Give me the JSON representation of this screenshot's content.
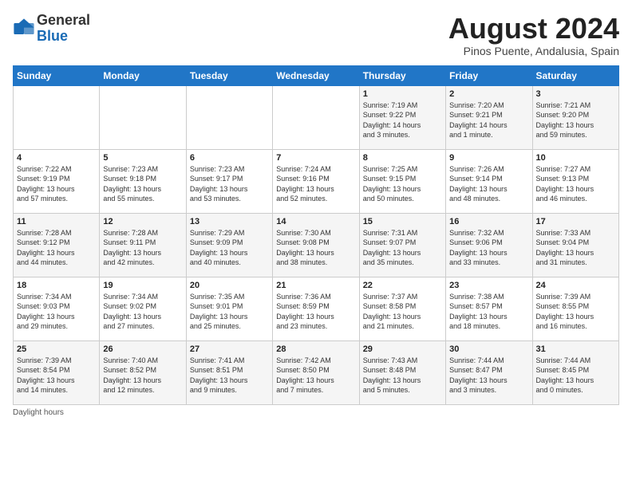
{
  "logo": {
    "general": "General",
    "blue": "Blue"
  },
  "title": "August 2024",
  "subtitle": "Pinos Puente, Andalusia, Spain",
  "days_of_week": [
    "Sunday",
    "Monday",
    "Tuesday",
    "Wednesday",
    "Thursday",
    "Friday",
    "Saturday"
  ],
  "footer": "Daylight hours",
  "weeks": [
    [
      {
        "num": "",
        "info": ""
      },
      {
        "num": "",
        "info": ""
      },
      {
        "num": "",
        "info": ""
      },
      {
        "num": "",
        "info": ""
      },
      {
        "num": "1",
        "info": "Sunrise: 7:19 AM\nSunset: 9:22 PM\nDaylight: 14 hours\nand 3 minutes."
      },
      {
        "num": "2",
        "info": "Sunrise: 7:20 AM\nSunset: 9:21 PM\nDaylight: 14 hours\nand 1 minute."
      },
      {
        "num": "3",
        "info": "Sunrise: 7:21 AM\nSunset: 9:20 PM\nDaylight: 13 hours\nand 59 minutes."
      }
    ],
    [
      {
        "num": "4",
        "info": "Sunrise: 7:22 AM\nSunset: 9:19 PM\nDaylight: 13 hours\nand 57 minutes."
      },
      {
        "num": "5",
        "info": "Sunrise: 7:23 AM\nSunset: 9:18 PM\nDaylight: 13 hours\nand 55 minutes."
      },
      {
        "num": "6",
        "info": "Sunrise: 7:23 AM\nSunset: 9:17 PM\nDaylight: 13 hours\nand 53 minutes."
      },
      {
        "num": "7",
        "info": "Sunrise: 7:24 AM\nSunset: 9:16 PM\nDaylight: 13 hours\nand 52 minutes."
      },
      {
        "num": "8",
        "info": "Sunrise: 7:25 AM\nSunset: 9:15 PM\nDaylight: 13 hours\nand 50 minutes."
      },
      {
        "num": "9",
        "info": "Sunrise: 7:26 AM\nSunset: 9:14 PM\nDaylight: 13 hours\nand 48 minutes."
      },
      {
        "num": "10",
        "info": "Sunrise: 7:27 AM\nSunset: 9:13 PM\nDaylight: 13 hours\nand 46 minutes."
      }
    ],
    [
      {
        "num": "11",
        "info": "Sunrise: 7:28 AM\nSunset: 9:12 PM\nDaylight: 13 hours\nand 44 minutes."
      },
      {
        "num": "12",
        "info": "Sunrise: 7:28 AM\nSunset: 9:11 PM\nDaylight: 13 hours\nand 42 minutes."
      },
      {
        "num": "13",
        "info": "Sunrise: 7:29 AM\nSunset: 9:09 PM\nDaylight: 13 hours\nand 40 minutes."
      },
      {
        "num": "14",
        "info": "Sunrise: 7:30 AM\nSunset: 9:08 PM\nDaylight: 13 hours\nand 38 minutes."
      },
      {
        "num": "15",
        "info": "Sunrise: 7:31 AM\nSunset: 9:07 PM\nDaylight: 13 hours\nand 35 minutes."
      },
      {
        "num": "16",
        "info": "Sunrise: 7:32 AM\nSunset: 9:06 PM\nDaylight: 13 hours\nand 33 minutes."
      },
      {
        "num": "17",
        "info": "Sunrise: 7:33 AM\nSunset: 9:04 PM\nDaylight: 13 hours\nand 31 minutes."
      }
    ],
    [
      {
        "num": "18",
        "info": "Sunrise: 7:34 AM\nSunset: 9:03 PM\nDaylight: 13 hours\nand 29 minutes."
      },
      {
        "num": "19",
        "info": "Sunrise: 7:34 AM\nSunset: 9:02 PM\nDaylight: 13 hours\nand 27 minutes."
      },
      {
        "num": "20",
        "info": "Sunrise: 7:35 AM\nSunset: 9:01 PM\nDaylight: 13 hours\nand 25 minutes."
      },
      {
        "num": "21",
        "info": "Sunrise: 7:36 AM\nSunset: 8:59 PM\nDaylight: 13 hours\nand 23 minutes."
      },
      {
        "num": "22",
        "info": "Sunrise: 7:37 AM\nSunset: 8:58 PM\nDaylight: 13 hours\nand 21 minutes."
      },
      {
        "num": "23",
        "info": "Sunrise: 7:38 AM\nSunset: 8:57 PM\nDaylight: 13 hours\nand 18 minutes."
      },
      {
        "num": "24",
        "info": "Sunrise: 7:39 AM\nSunset: 8:55 PM\nDaylight: 13 hours\nand 16 minutes."
      }
    ],
    [
      {
        "num": "25",
        "info": "Sunrise: 7:39 AM\nSunset: 8:54 PM\nDaylight: 13 hours\nand 14 minutes."
      },
      {
        "num": "26",
        "info": "Sunrise: 7:40 AM\nSunset: 8:52 PM\nDaylight: 13 hours\nand 12 minutes."
      },
      {
        "num": "27",
        "info": "Sunrise: 7:41 AM\nSunset: 8:51 PM\nDaylight: 13 hours\nand 9 minutes."
      },
      {
        "num": "28",
        "info": "Sunrise: 7:42 AM\nSunset: 8:50 PM\nDaylight: 13 hours\nand 7 minutes."
      },
      {
        "num": "29",
        "info": "Sunrise: 7:43 AM\nSunset: 8:48 PM\nDaylight: 13 hours\nand 5 minutes."
      },
      {
        "num": "30",
        "info": "Sunrise: 7:44 AM\nSunset: 8:47 PM\nDaylight: 13 hours\nand 3 minutes."
      },
      {
        "num": "31",
        "info": "Sunrise: 7:44 AM\nSunset: 8:45 PM\nDaylight: 13 hours\nand 0 minutes."
      }
    ]
  ]
}
